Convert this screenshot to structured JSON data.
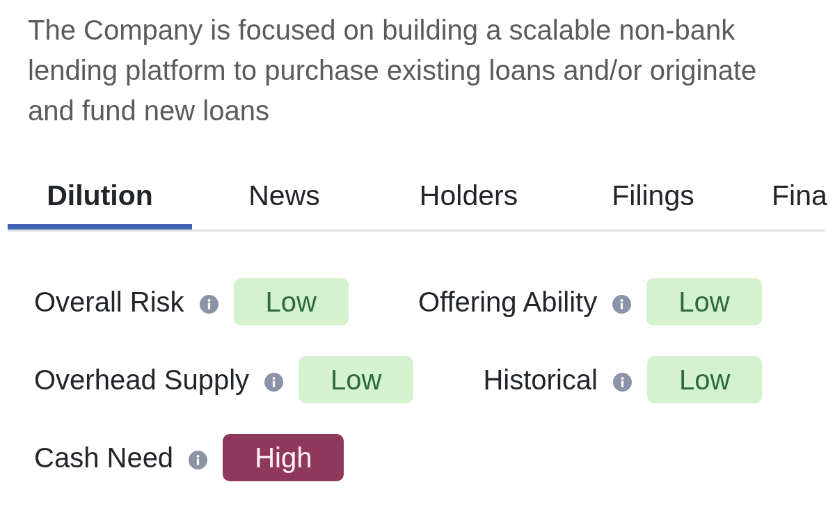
{
  "description": "The Company is focused on building a scalable non-bank lending platform to purchase existing loans and/or originate and fund new loans",
  "tabs": [
    {
      "label": "Dilution",
      "selected": true
    },
    {
      "label": "News",
      "selected": false
    },
    {
      "label": "Holders",
      "selected": false
    },
    {
      "label": "Filings",
      "selected": false
    },
    {
      "label": "Fina",
      "selected": false
    }
  ],
  "metrics": [
    {
      "label": "Overall Risk",
      "rating": "Low",
      "kind": "low"
    },
    {
      "label": "Offering Ability",
      "rating": "Low",
      "kind": "low"
    },
    {
      "label": "Overhead Supply",
      "rating": "Low",
      "kind": "low"
    },
    {
      "label": "Historical",
      "rating": "Low",
      "kind": "low"
    },
    {
      "label": "Cash Need",
      "rating": "High",
      "kind": "high"
    }
  ]
}
